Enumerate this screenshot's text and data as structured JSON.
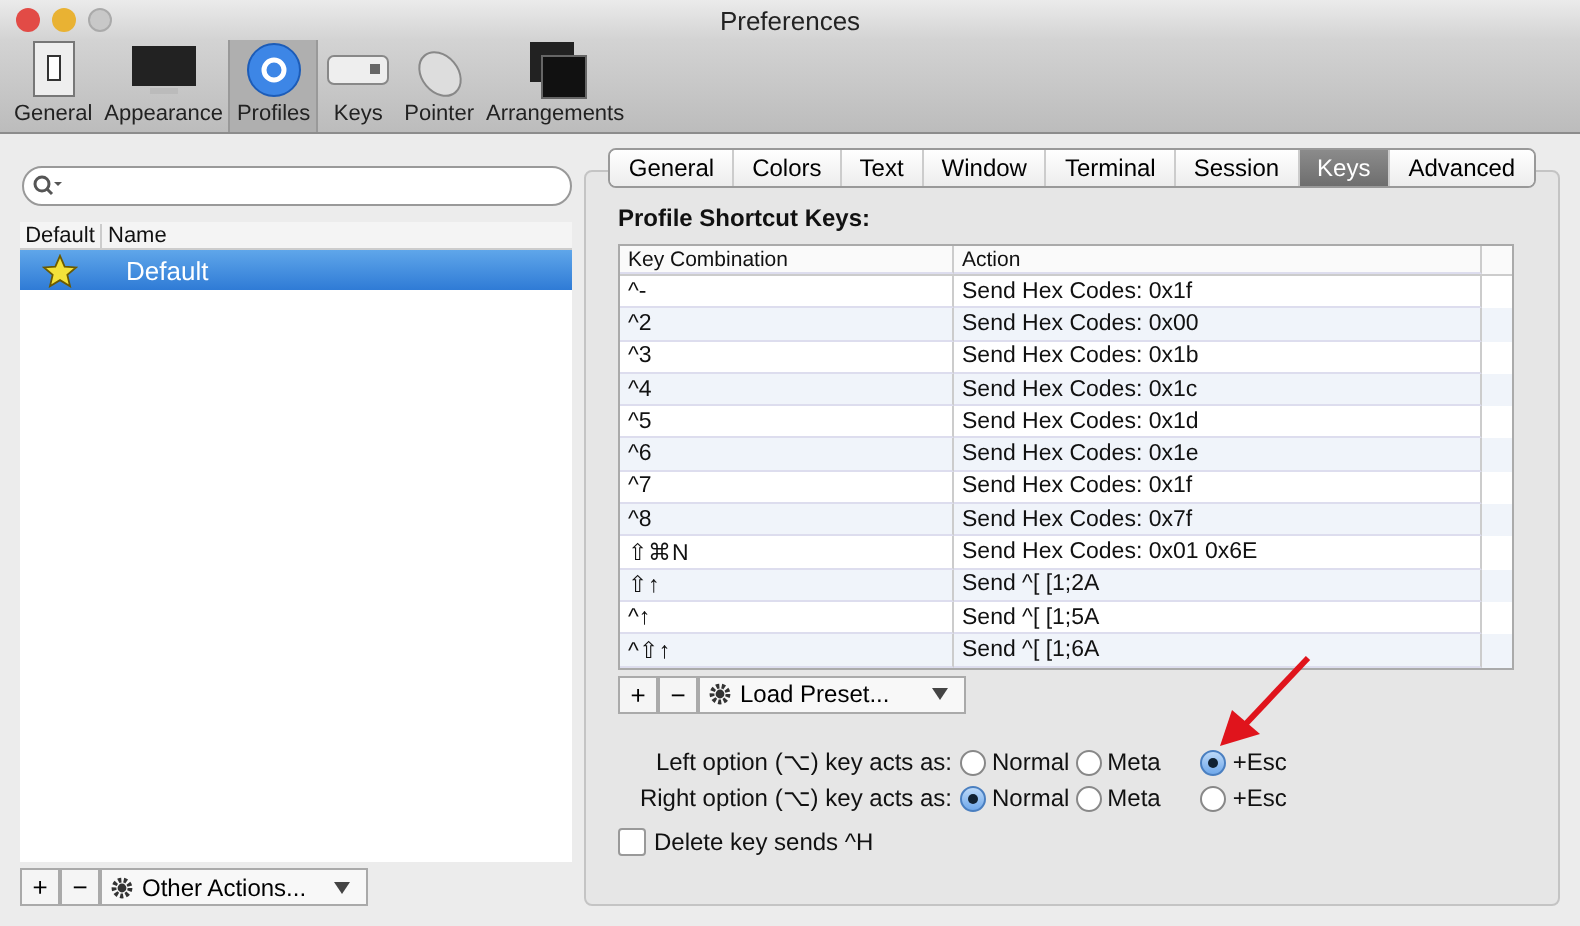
{
  "window": {
    "title": "Preferences"
  },
  "toolbar": [
    {
      "label": "General",
      "selected": false
    },
    {
      "label": "Appearance",
      "selected": false
    },
    {
      "label": "Profiles",
      "selected": true
    },
    {
      "label": "Keys",
      "selected": false
    },
    {
      "label": "Pointer",
      "selected": false
    },
    {
      "label": "Arrangements",
      "selected": false
    }
  ],
  "profiles": {
    "columns": [
      "Default",
      "Name"
    ],
    "rows": [
      {
        "name": "Default",
        "default": true,
        "selected": true
      }
    ],
    "buttons": [
      "+",
      "−"
    ],
    "menu": "Other Actions..."
  },
  "tabs": [
    {
      "label": "General",
      "selected": false
    },
    {
      "label": "Colors",
      "selected": false
    },
    {
      "label": "Text",
      "selected": false
    },
    {
      "label": "Window",
      "selected": false
    },
    {
      "label": "Terminal",
      "selected": false
    },
    {
      "label": "Session",
      "selected": false
    },
    {
      "label": "Keys",
      "selected": true
    },
    {
      "label": "Advanced",
      "selected": false
    }
  ],
  "section_title": "Profile Shortcut Keys:",
  "shortcuts": {
    "columns": [
      "Key Combination",
      "Action"
    ],
    "rows": [
      [
        "^-",
        "Send Hex Codes: 0x1f"
      ],
      [
        "^2",
        "Send Hex Codes: 0x00"
      ],
      [
        "^3",
        "Send Hex Codes: 0x1b"
      ],
      [
        "^4",
        "Send Hex Codes: 0x1c"
      ],
      [
        "^5",
        "Send Hex Codes: 0x1d"
      ],
      [
        "^6",
        "Send Hex Codes: 0x1e"
      ],
      [
        "^7",
        "Send Hex Codes: 0x1f"
      ],
      [
        "^8",
        "Send Hex Codes: 0x7f"
      ],
      [
        "⇧⌘N",
        "Send Hex Codes: 0x01 0x6E"
      ],
      [
        "⇧↑",
        "Send ^[ [1;2A"
      ],
      [
        "^↑",
        "Send ^[ [1;5A"
      ],
      [
        "^⇧↑",
        "Send ^[ [1;6A"
      ]
    ],
    "buttons": [
      "+",
      "−"
    ],
    "menu": "Load Preset..."
  },
  "options": [
    {
      "label": "Left option (⌥) key acts as:",
      "choices": [
        {
          "label": "Normal",
          "selected": false
        },
        {
          "label": "Meta",
          "selected": false
        },
        {
          "label": "+Esc",
          "selected": true
        }
      ]
    },
    {
      "label": "Right option (⌥) key acts as:",
      "choices": [
        {
          "label": "Normal",
          "selected": true
        },
        {
          "label": "Meta",
          "selected": false
        },
        {
          "label": "+Esc",
          "selected": false
        }
      ]
    }
  ],
  "delete_key": {
    "label": "Delete key sends ^H",
    "checked": false
  }
}
